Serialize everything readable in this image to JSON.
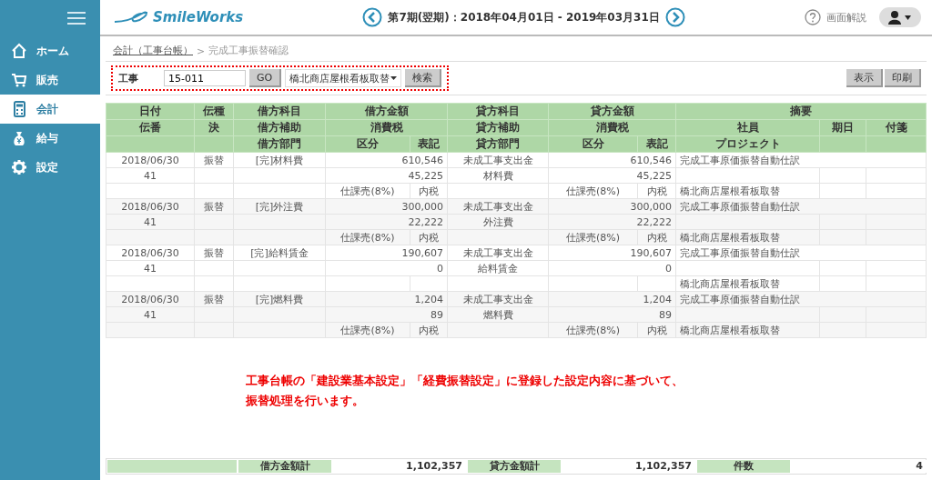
{
  "app": {
    "logo": "SmileWorks",
    "period": "第7期(翌期)：2018年04月01日 - 2019年03月31日",
    "help": "画面解説"
  },
  "sidebar": {
    "items": [
      {
        "label": "ホーム",
        "selected": false
      },
      {
        "label": "販売",
        "selected": false
      },
      {
        "label": "会計",
        "selected": true
      },
      {
        "label": "給与",
        "selected": false
      },
      {
        "label": "設定",
        "selected": false
      }
    ]
  },
  "breadcrumb": {
    "link": "会計（工事台帳）",
    "separator": ">",
    "current": "完成工事振替確認"
  },
  "filter": {
    "label": "工事",
    "code": "15-011",
    "go": "GO",
    "project": "橋北商店屋根看板取替",
    "search": "検索"
  },
  "actions": [
    "表示",
    "印刷"
  ],
  "table": {
    "header_rows": [
      [
        "日付",
        "伝種",
        "借方科目",
        "借方金額",
        "貸方科目",
        "貸方金額",
        "摘要"
      ],
      [
        "伝番",
        "決",
        "借方補助",
        "消費税",
        "貸方補助",
        "消費税",
        "社員",
        "期日",
        "付箋"
      ],
      [
        "",
        "",
        "借方部門",
        "区分",
        "表記",
        "貸方部門",
        "区分",
        "表記",
        "プロジェクト"
      ]
    ],
    "entries": [
      {
        "date": "2018/06/30",
        "number": "41",
        "type": "振替",
        "debit_account": "[完]材料費",
        "debit_amount": "610,546",
        "debit_tax": "45,225",
        "debit_tax_class": "仕課売(8%)",
        "debit_tax_notation": "内税",
        "credit_account": "未成工事支出金",
        "credit_sub": "材料費",
        "credit_amount": "610,546",
        "credit_tax": "45,225",
        "credit_tax_class": "仕課売(8%)",
        "credit_tax_notation": "内税",
        "memo": "完成工事原価振替自動仕訳",
        "project": "橋北商店屋根看板取替"
      },
      {
        "date": "2018/06/30",
        "number": "41",
        "type": "振替",
        "debit_account": "[完]外注費",
        "debit_amount": "300,000",
        "debit_tax": "22,222",
        "debit_tax_class": "仕課売(8%)",
        "debit_tax_notation": "内税",
        "credit_account": "未成工事支出金",
        "credit_sub": "外注費",
        "credit_amount": "300,000",
        "credit_tax": "22,222",
        "credit_tax_class": "仕課売(8%)",
        "credit_tax_notation": "内税",
        "memo": "完成工事原価振替自動仕訳",
        "project": "橋北商店屋根看板取替"
      },
      {
        "date": "2018/06/30",
        "number": "41",
        "type": "振替",
        "debit_account": "[完]給料賃金",
        "debit_amount": "190,607",
        "debit_tax": "0",
        "credit_account": "未成工事支出金",
        "credit_sub": "給料賃金",
        "credit_amount": "190,607",
        "credit_tax": "0",
        "memo": "完成工事原価振替自動仕訳",
        "project": "橋北商店屋根看板取替"
      },
      {
        "date": "2018/06/30",
        "number": "41",
        "type": "振替",
        "debit_account": "[完]燃料費",
        "debit_amount": "1,204",
        "debit_tax": "89",
        "debit_tax_class": "仕課売(8%)",
        "debit_tax_notation": "内税",
        "credit_account": "未成工事支出金",
        "credit_sub": "燃料費",
        "credit_amount": "1,204",
        "credit_tax": "89",
        "credit_tax_class": "仕課売(8%)",
        "credit_tax_notation": "内税",
        "memo": "完成工事原価振替自動仕訳",
        "project": "橋北商店屋根看板取替"
      }
    ]
  },
  "note": [
    "工事台帳の「建設業基本設定」「経費振替設定」に登録した設定内容に基づいて、",
    "振替処理を行います。"
  ],
  "totals": {
    "debit_label": "借方金額計",
    "debit_total": "1,102,357",
    "credit_label": "貸方金額計",
    "credit_total": "1,102,357",
    "count_label": "件数",
    "count": "4"
  }
}
